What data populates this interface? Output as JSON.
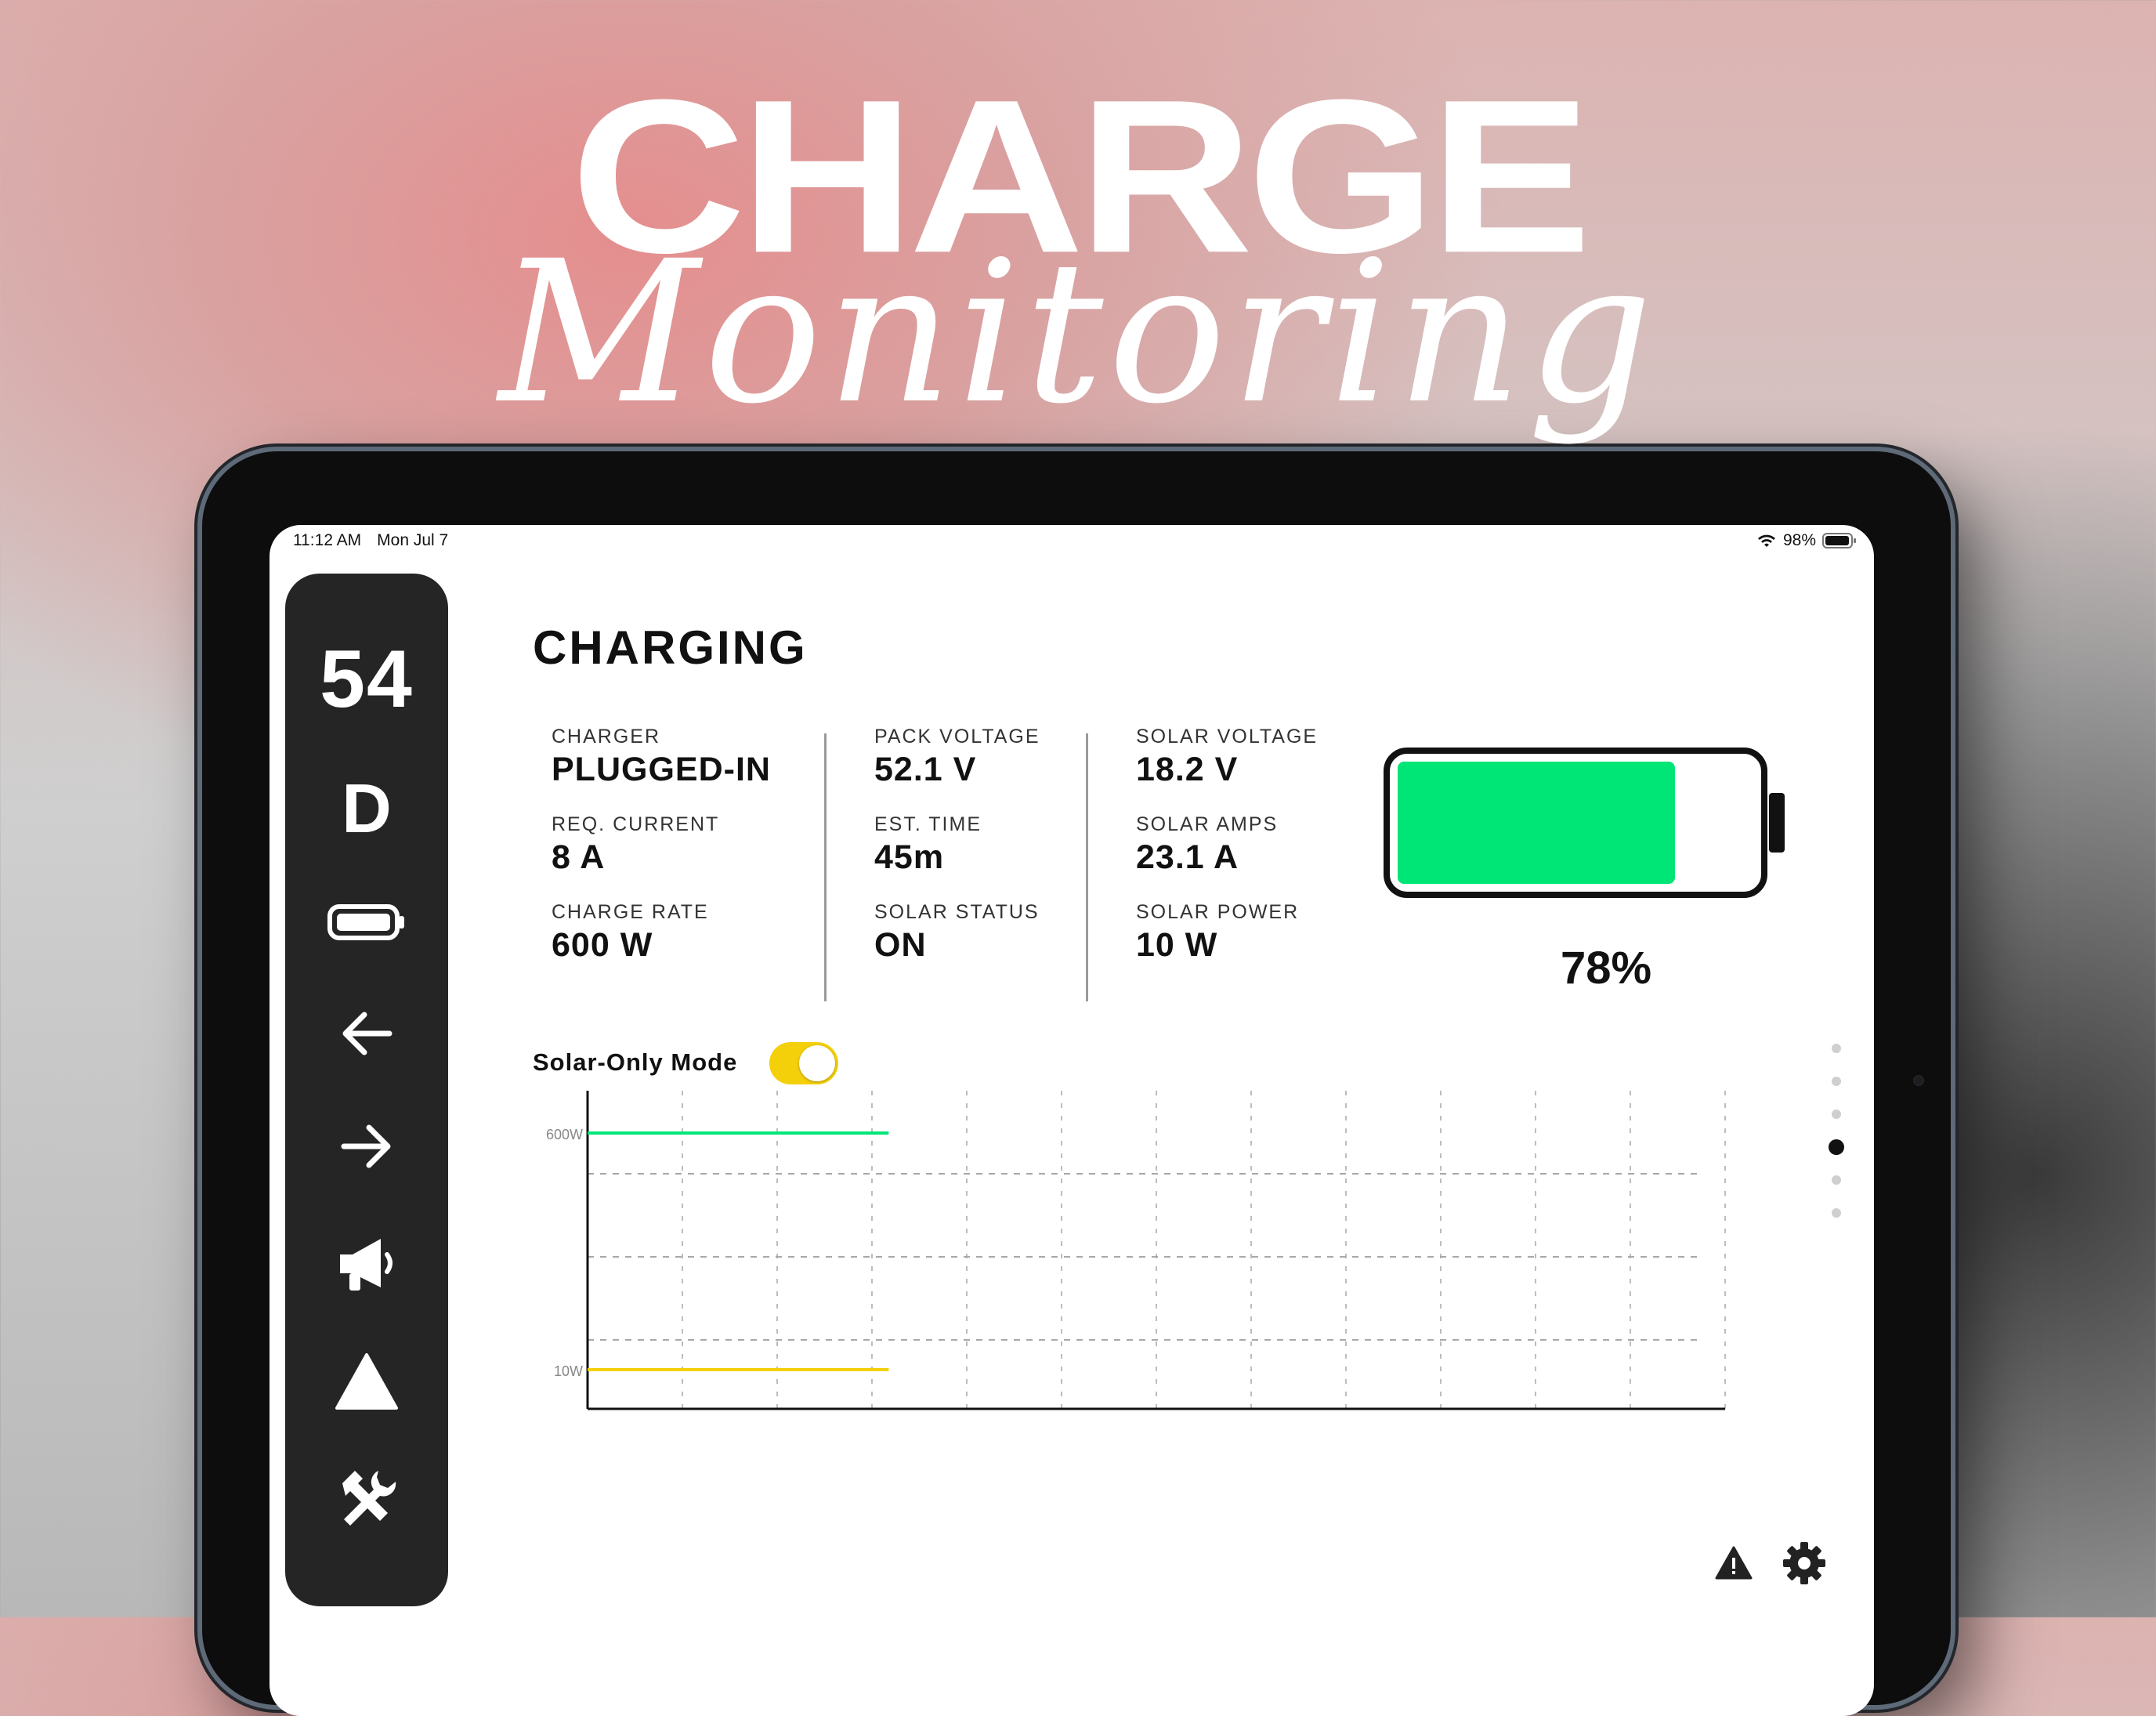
{
  "hero": {
    "title": "CHARGE",
    "script": "Monitoring"
  },
  "statusbar": {
    "time": "11:12 AM",
    "date": "Mon Jul 7",
    "battery_pct": "98%"
  },
  "sidebar": {
    "speed": "54",
    "gear": "D",
    "icons": [
      "battery-icon",
      "arrow-left-icon",
      "arrow-right-icon",
      "megaphone-icon",
      "warning-triangle-icon",
      "tools-icon"
    ]
  },
  "main": {
    "title": "CHARGING",
    "stats": [
      {
        "label": "CHARGER",
        "value": "PLUGGED-IN"
      },
      {
        "label": "REQ. CURRENT",
        "value": "8 A"
      },
      {
        "label": "CHARGE RATE",
        "value": "600 W"
      },
      {
        "label": "PACK VOLTAGE",
        "value": "52.1 V"
      },
      {
        "label": "EST. TIME",
        "value": "45m"
      },
      {
        "label": "SOLAR STATUS",
        "value": "ON"
      },
      {
        "label": "SOLAR VOLTAGE",
        "value": "18.2 V"
      },
      {
        "label": "SOLAR AMPS",
        "value": "23.1 A"
      },
      {
        "label": "SOLAR POWER",
        "value": "10 W"
      }
    ],
    "battery": {
      "level": 0.78,
      "percent_text": "78%",
      "fill_color": "#00e676"
    },
    "solar_only": {
      "label": "Solar-Only Mode",
      "on": true,
      "color": "#f4d00b"
    }
  },
  "pager": {
    "count": 6,
    "active_index": 3
  },
  "chart_data": {
    "type": "line",
    "y_tick_labels": [
      "600W",
      "10W"
    ],
    "series": [
      {
        "color": "#00e676",
        "x": [
          0,
          1
        ],
        "values": [
          600,
          600
        ]
      },
      {
        "color": "#f4d00b",
        "x": [
          0,
          1
        ],
        "values": [
          10,
          10
        ]
      }
    ],
    "x_range": [
      0,
      3.7
    ],
    "grid": true
  },
  "bottom": {
    "icons": [
      "alert-icon",
      "settings-gear-icon"
    ]
  },
  "colors": {
    "sidebar_bg": "#252525",
    "accent_green": "#00e676",
    "accent_yellow": "#f4d00b"
  }
}
